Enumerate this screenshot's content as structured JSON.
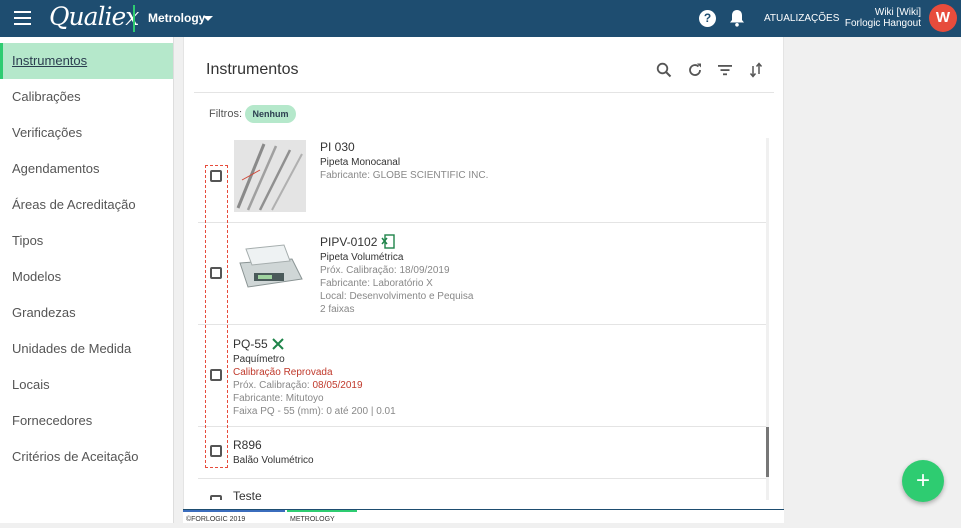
{
  "topbar": {
    "logo": "Qualiex",
    "module": "Metrology",
    "updates_label": "ATUALIZAÇÕES",
    "user_name": "Wiki [Wiki]",
    "user_org": "Forlogic Hangout",
    "avatar_letter": "W",
    "icons": [
      "menu-icon",
      "help-icon",
      "bell-icon"
    ]
  },
  "sidebar": {
    "items": [
      {
        "label": "Instrumentos",
        "active": true
      },
      {
        "label": "Calibrações"
      },
      {
        "label": "Verificações"
      },
      {
        "label": "Agendamentos"
      },
      {
        "label": "Áreas de Acreditação"
      },
      {
        "label": "Tipos"
      },
      {
        "label": "Modelos"
      },
      {
        "label": "Grandezas"
      },
      {
        "label": "Unidades de Medida"
      },
      {
        "label": "Locais"
      },
      {
        "label": "Fornecedores"
      },
      {
        "label": "Critérios de Aceitação"
      }
    ]
  },
  "main": {
    "title": "Instrumentos",
    "toolbar_icons": [
      "search-icon",
      "refresh-icon",
      "filter-icon",
      "sort-icon"
    ],
    "filters_label": "Filtros:",
    "filter_chip": "Nenhum",
    "items": [
      {
        "code": "PI 030",
        "type": "Pipeta Monocanal",
        "manufacturer": "Fabricante: GLOBE SCIENTIFIC INC."
      },
      {
        "code": "PIPV-0102",
        "type": "Pipeta Volumétrica",
        "next_calibration": "Próx. Calibração: 18/09/2019",
        "manufacturer": "Fabricante: Laboratório X",
        "location": "Local: Desenvolvimento e Pequisa",
        "ranges": "2 faixas",
        "icon": "excel-icon"
      },
      {
        "code": "PQ-55",
        "type": "Paquímetro",
        "status": "Calibração Reprovada",
        "next_calibration_label": "Próx. Calibração: ",
        "next_calibration_date": "08/05/2019",
        "manufacturer": "Fabricante: Mitutoyo",
        "range": "Faixa PQ - 55 (mm): 0 até 200 | 0.01",
        "icon": "failed-x-icon"
      },
      {
        "code": "R896",
        "type": "Balão Volumétrico"
      },
      {
        "code": "Teste"
      }
    ]
  },
  "footer": {
    "left": "©FORLOGIC 2019",
    "right": "METROLOGY"
  },
  "fab_label": "+",
  "colors": {
    "topbar": "#1e4d70",
    "accent": "#2ecc71",
    "active_bg": "#b5e8cb",
    "danger": "#c0392b",
    "avatar": "#e74c3c"
  }
}
